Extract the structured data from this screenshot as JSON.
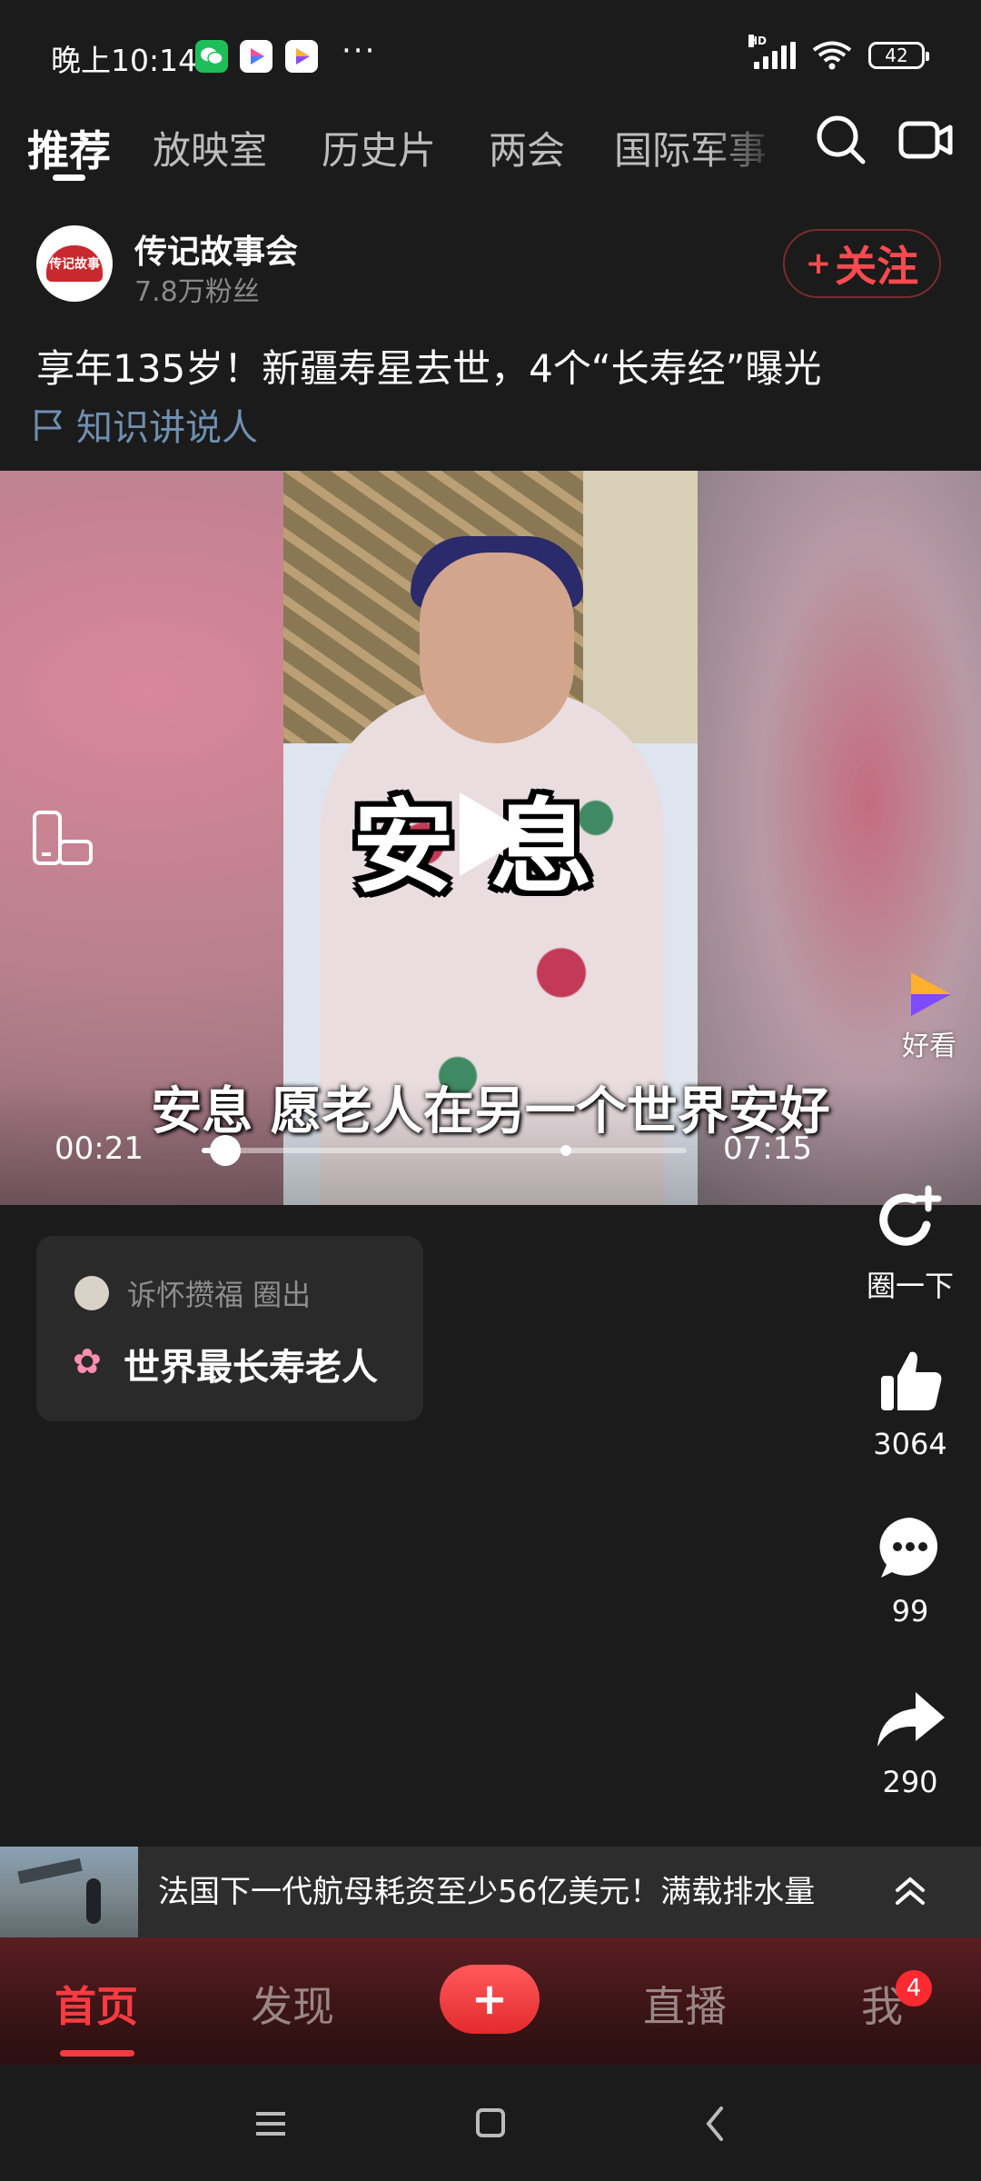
{
  "status_bar": {
    "time": "晚上10:14",
    "more": "···",
    "network": "HD",
    "battery": "42"
  },
  "top_tabs": [
    {
      "label": "推荐",
      "active": true
    },
    {
      "label": "放映室"
    },
    {
      "label": "历史片"
    },
    {
      "label": "两会"
    },
    {
      "label": "国际军事"
    }
  ],
  "post": {
    "author_name": "传记故事会",
    "author_fans": "7.8万粉丝",
    "avatar_text": "传记故事",
    "follow_label": "关注",
    "title": "享年135岁！新疆寿星去世，4个“长寿经”曝光",
    "topic": "知识讲说人"
  },
  "video": {
    "sticker_text": "安息",
    "subtitle": "安息 愿老人在另一个世界安好",
    "current_time": "00:21",
    "total_time": "07:15",
    "progress": 0.049,
    "buffered": 0.75,
    "app_badge": "好看"
  },
  "circle_card": {
    "user": "诉怀攒福 圈出",
    "topic": "世界最长寿老人"
  },
  "actions": {
    "circle_label": "圈一下",
    "likes": "3064",
    "comments": "99",
    "shares": "290"
  },
  "next_video": {
    "title": "法国下一代航母耗资至少56亿美元！满载排水量"
  },
  "bottom_nav": {
    "home": "首页",
    "discover": "发现",
    "publish": "+",
    "live": "直播",
    "me": "我",
    "me_badge": "4"
  },
  "colors": {
    "accent": "#ff3b41",
    "background": "#1b1b1b",
    "topic": "#6f8fb0"
  }
}
